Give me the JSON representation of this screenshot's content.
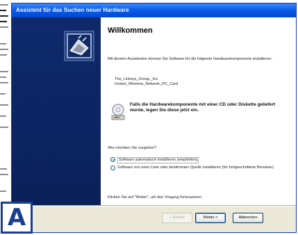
{
  "window": {
    "title": "Assistent für das Suchen neuer Hardware"
  },
  "page": {
    "heading": "Willkommen",
    "intro": "Mit diesem Assistenten können Sie Software für die folgende Hardwarekomponente installieren:",
    "device_line1": "The_Linksys_Group,_Inc.",
    "device_line2": "Instant_Wireless_Network_PC_Card",
    "cd_hint": "Falls die Hardwarekomponente mit einer CD oder Diskette geliefert wurde, legen Sie diese jetzt ein.",
    "question": "Wie möchten Sie vorgehen?",
    "options": [
      {
        "label": "Software automatisch installieren (empfohlen)",
        "selected": true
      },
      {
        "label": "Software von einer Liste oder bestimmten Quelle installieren (für fortgeschrittene Benutzer)",
        "selected": false
      }
    ],
    "finish_hint": "Klicken Sie auf \"Weiter\", um den Vorgang fortzusetzen."
  },
  "buttons": {
    "back": "< Zurück",
    "next": "Weiter >",
    "cancel": "Abbrechen"
  },
  "badge": {
    "label": "A"
  },
  "colors": {
    "title_bar": "#0a5ce8",
    "side_panel": "#0c2562",
    "badge": "#1a3f8f"
  }
}
